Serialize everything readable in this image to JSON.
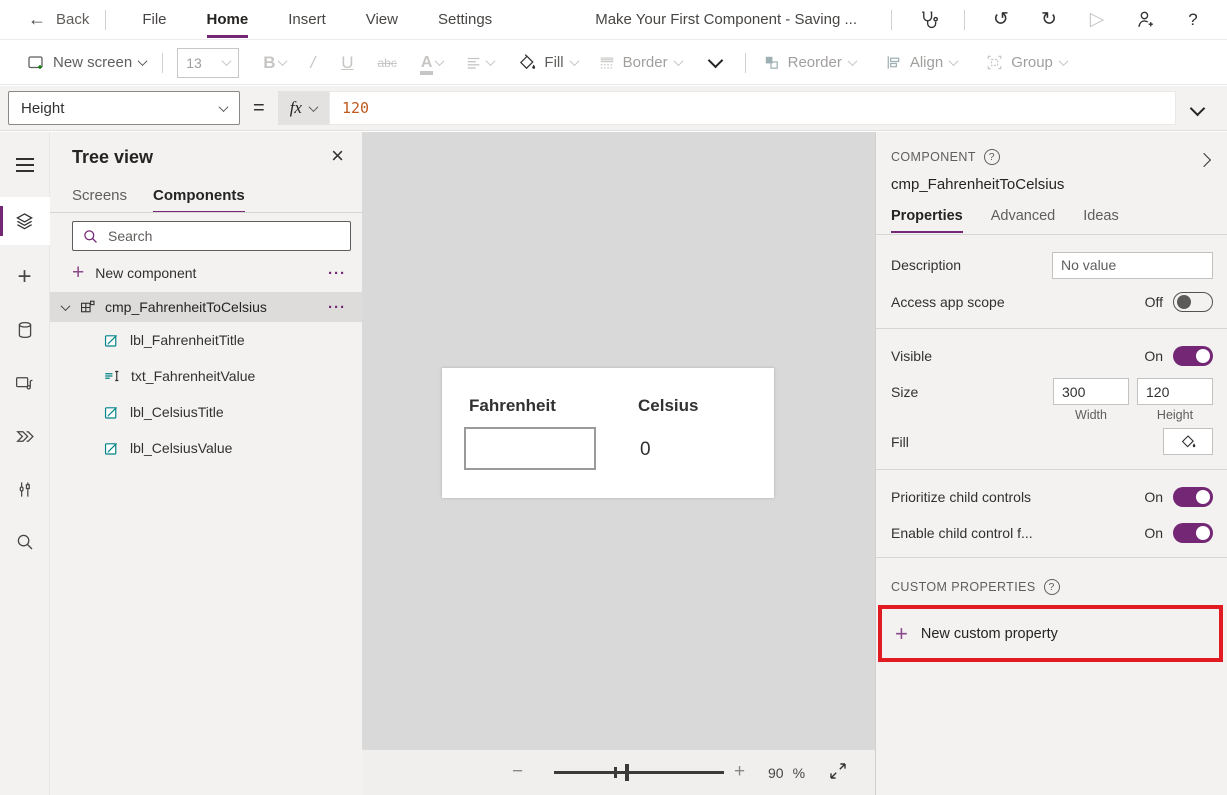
{
  "colors": {
    "brand_purple": "#742774",
    "highlight_red": "#e11b22",
    "control_teal": "#038387",
    "formula_value_orange": "#c05a21"
  },
  "glyphs": {
    "back_arrow": "←",
    "close": "×",
    "ellipsis": "···",
    "equals": "=",
    "undo": "↺",
    "redo": "↻",
    "play": "▷",
    "help": "?",
    "minus": "−",
    "plus": "+"
  },
  "top_bar": {
    "back_label": "Back",
    "menus": [
      {
        "label": "File"
      },
      {
        "label": "Home"
      },
      {
        "label": "Insert"
      },
      {
        "label": "View"
      },
      {
        "label": "Settings"
      }
    ],
    "title": "Make Your First Component - Saving ..."
  },
  "toolbar": {
    "new_screen_label": "New screen",
    "font_size_value": "13",
    "bold_label": "B",
    "italic_label": "/",
    "underline_label": "U",
    "strikethrough_label": "abc",
    "font_color_label": "A",
    "fill_label": "Fill",
    "border_label": "Border",
    "reorder_label": "Reorder",
    "align_label": "Align",
    "group_label": "Group"
  },
  "formula_bar": {
    "property_selected": "Height",
    "fx_label": "fx",
    "formula_value": "120"
  },
  "left_rail": {
    "icons": [
      "hamburger-icon",
      "tree-view-layers-icon",
      "insert-plus-icon",
      "data-cylinder-icon",
      "media-icon",
      "power-automate-icon",
      "advanced-tools-icon",
      "search-icon"
    ]
  },
  "tree_panel": {
    "title": "Tree view",
    "tabs": [
      {
        "label": "Screens"
      },
      {
        "label": "Components"
      }
    ],
    "search_placeholder": "Search",
    "new_component_label": "New component",
    "parent": {
      "name": "cmp_FahrenheitToCelsius"
    },
    "children": [
      {
        "name": "lbl_FahrenheitTitle",
        "icon": "label-icon"
      },
      {
        "name": "txt_FahrenheitValue",
        "icon": "text-input-icon"
      },
      {
        "name": "lbl_CelsiusTitle",
        "icon": "label-icon"
      },
      {
        "name": "lbl_CelsiusValue",
        "icon": "label-icon"
      }
    ]
  },
  "canvas": {
    "fahrenheit_label": "Fahrenheit",
    "celsius_label": "Celsius",
    "celsius_value": "0",
    "zoom_percent": "90",
    "percent_sign": "%"
  },
  "right_panel": {
    "header": "COMPONENT",
    "component_name": "cmp_FahrenheitToCelsius",
    "tabs": [
      {
        "label": "Properties"
      },
      {
        "label": "Advanced"
      },
      {
        "label": "Ideas"
      }
    ],
    "properties": {
      "description_label": "Description",
      "description_placeholder": "No value",
      "access_app_scope_label": "Access app scope",
      "access_app_scope_state": "Off",
      "visible_label": "Visible",
      "visible_state": "On",
      "size_label": "Size",
      "width_value": "300",
      "height_value": "120",
      "width_caption": "Width",
      "height_caption": "Height",
      "fill_label": "Fill",
      "prioritize_label": "Prioritize child controls",
      "prioritize_state": "On",
      "enable_child_label": "Enable child control f...",
      "enable_child_state": "On"
    },
    "custom_properties_header": "CUSTOM PROPERTIES",
    "new_custom_property_label": "New custom property"
  }
}
